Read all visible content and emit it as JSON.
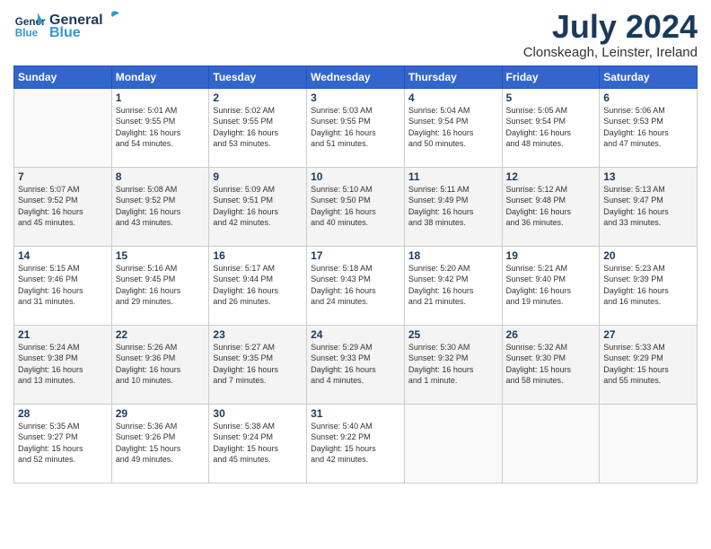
{
  "logo": {
    "line1": "General",
    "line2": "Blue"
  },
  "title": "July 2024",
  "location": "Clonskeagh, Leinster, Ireland",
  "days_of_week": [
    "Sunday",
    "Monday",
    "Tuesday",
    "Wednesday",
    "Thursday",
    "Friday",
    "Saturday"
  ],
  "weeks": [
    [
      {
        "day": "",
        "info": ""
      },
      {
        "day": "1",
        "info": "Sunrise: 5:01 AM\nSunset: 9:55 PM\nDaylight: 16 hours\nand 54 minutes."
      },
      {
        "day": "2",
        "info": "Sunrise: 5:02 AM\nSunset: 9:55 PM\nDaylight: 16 hours\nand 53 minutes."
      },
      {
        "day": "3",
        "info": "Sunrise: 5:03 AM\nSunset: 9:55 PM\nDaylight: 16 hours\nand 51 minutes."
      },
      {
        "day": "4",
        "info": "Sunrise: 5:04 AM\nSunset: 9:54 PM\nDaylight: 16 hours\nand 50 minutes."
      },
      {
        "day": "5",
        "info": "Sunrise: 5:05 AM\nSunset: 9:54 PM\nDaylight: 16 hours\nand 48 minutes."
      },
      {
        "day": "6",
        "info": "Sunrise: 5:06 AM\nSunset: 9:53 PM\nDaylight: 16 hours\nand 47 minutes."
      }
    ],
    [
      {
        "day": "7",
        "info": "Sunrise: 5:07 AM\nSunset: 9:52 PM\nDaylight: 16 hours\nand 45 minutes."
      },
      {
        "day": "8",
        "info": "Sunrise: 5:08 AM\nSunset: 9:52 PM\nDaylight: 16 hours\nand 43 minutes."
      },
      {
        "day": "9",
        "info": "Sunrise: 5:09 AM\nSunset: 9:51 PM\nDaylight: 16 hours\nand 42 minutes."
      },
      {
        "day": "10",
        "info": "Sunrise: 5:10 AM\nSunset: 9:50 PM\nDaylight: 16 hours\nand 40 minutes."
      },
      {
        "day": "11",
        "info": "Sunrise: 5:11 AM\nSunset: 9:49 PM\nDaylight: 16 hours\nand 38 minutes."
      },
      {
        "day": "12",
        "info": "Sunrise: 5:12 AM\nSunset: 9:48 PM\nDaylight: 16 hours\nand 36 minutes."
      },
      {
        "day": "13",
        "info": "Sunrise: 5:13 AM\nSunset: 9:47 PM\nDaylight: 16 hours\nand 33 minutes."
      }
    ],
    [
      {
        "day": "14",
        "info": "Sunrise: 5:15 AM\nSunset: 9:46 PM\nDaylight: 16 hours\nand 31 minutes."
      },
      {
        "day": "15",
        "info": "Sunrise: 5:16 AM\nSunset: 9:45 PM\nDaylight: 16 hours\nand 29 minutes."
      },
      {
        "day": "16",
        "info": "Sunrise: 5:17 AM\nSunset: 9:44 PM\nDaylight: 16 hours\nand 26 minutes."
      },
      {
        "day": "17",
        "info": "Sunrise: 5:18 AM\nSunset: 9:43 PM\nDaylight: 16 hours\nand 24 minutes."
      },
      {
        "day": "18",
        "info": "Sunrise: 5:20 AM\nSunset: 9:42 PM\nDaylight: 16 hours\nand 21 minutes."
      },
      {
        "day": "19",
        "info": "Sunrise: 5:21 AM\nSunset: 9:40 PM\nDaylight: 16 hours\nand 19 minutes."
      },
      {
        "day": "20",
        "info": "Sunrise: 5:23 AM\nSunset: 9:39 PM\nDaylight: 16 hours\nand 16 minutes."
      }
    ],
    [
      {
        "day": "21",
        "info": "Sunrise: 5:24 AM\nSunset: 9:38 PM\nDaylight: 16 hours\nand 13 minutes."
      },
      {
        "day": "22",
        "info": "Sunrise: 5:26 AM\nSunset: 9:36 PM\nDaylight: 16 hours\nand 10 minutes."
      },
      {
        "day": "23",
        "info": "Sunrise: 5:27 AM\nSunset: 9:35 PM\nDaylight: 16 hours\nand 7 minutes."
      },
      {
        "day": "24",
        "info": "Sunrise: 5:29 AM\nSunset: 9:33 PM\nDaylight: 16 hours\nand 4 minutes."
      },
      {
        "day": "25",
        "info": "Sunrise: 5:30 AM\nSunset: 9:32 PM\nDaylight: 16 hours\nand 1 minute."
      },
      {
        "day": "26",
        "info": "Sunrise: 5:32 AM\nSunset: 9:30 PM\nDaylight: 15 hours\nand 58 minutes."
      },
      {
        "day": "27",
        "info": "Sunrise: 5:33 AM\nSunset: 9:29 PM\nDaylight: 15 hours\nand 55 minutes."
      }
    ],
    [
      {
        "day": "28",
        "info": "Sunrise: 5:35 AM\nSunset: 9:27 PM\nDaylight: 15 hours\nand 52 minutes."
      },
      {
        "day": "29",
        "info": "Sunrise: 5:36 AM\nSunset: 9:26 PM\nDaylight: 15 hours\nand 49 minutes."
      },
      {
        "day": "30",
        "info": "Sunrise: 5:38 AM\nSunset: 9:24 PM\nDaylight: 15 hours\nand 45 minutes."
      },
      {
        "day": "31",
        "info": "Sunrise: 5:40 AM\nSunset: 9:22 PM\nDaylight: 15 hours\nand 42 minutes."
      },
      {
        "day": "",
        "info": ""
      },
      {
        "day": "",
        "info": ""
      },
      {
        "day": "",
        "info": ""
      }
    ]
  ]
}
